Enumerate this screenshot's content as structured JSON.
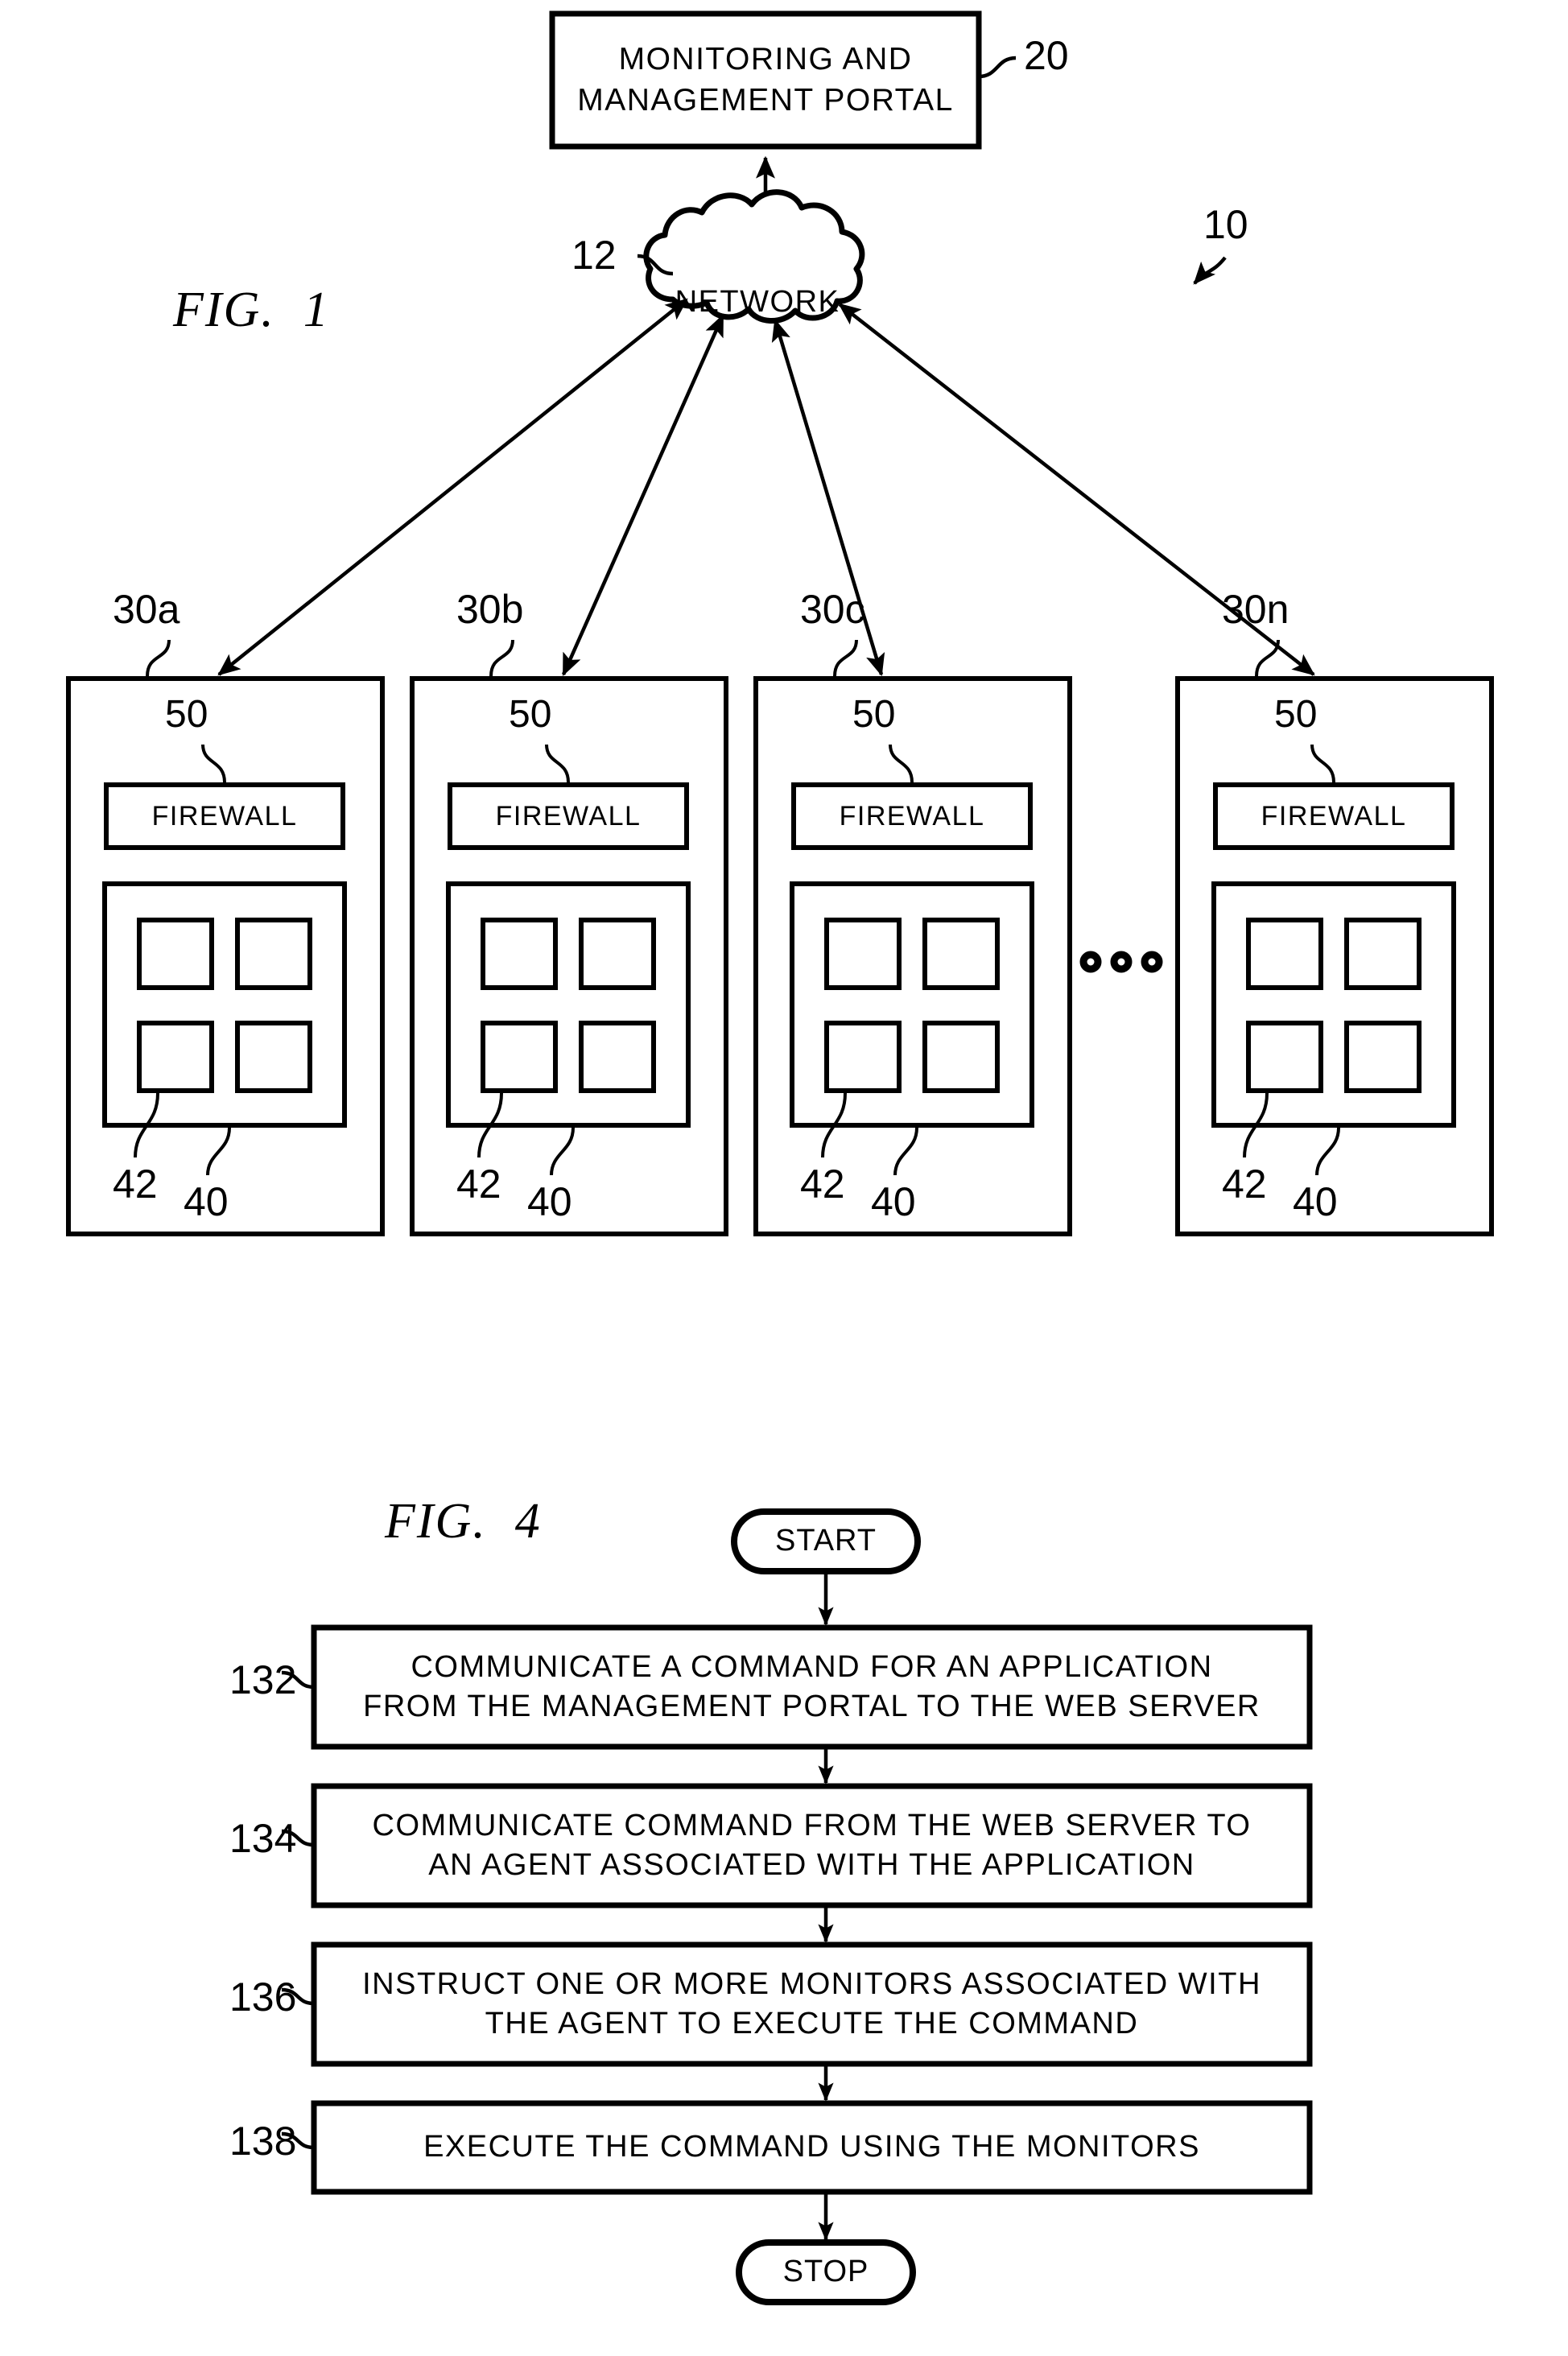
{
  "figures": [
    {
      "id": "fig1",
      "label": "FIG.  1",
      "system_ref": "10",
      "portal": {
        "title": "MONITORING AND\nMANAGEMENT PORTAL",
        "ref": "20"
      },
      "network": {
        "label": "NETWORK",
        "ref": "12"
      },
      "servers": [
        {
          "ref": "30a",
          "firewall_label": "FIREWALL",
          "firewall_ref": "50",
          "agent_ref": "40",
          "monitor_ref": "42"
        },
        {
          "ref": "30b",
          "firewall_label": "FIREWALL",
          "firewall_ref": "50",
          "agent_ref": "40",
          "monitor_ref": "42"
        },
        {
          "ref": "30c",
          "firewall_label": "FIREWALL",
          "firewall_ref": "50",
          "agent_ref": "40",
          "monitor_ref": "42"
        },
        {
          "ref": "30n",
          "firewall_label": "FIREWALL",
          "firewall_ref": "50",
          "agent_ref": "40",
          "monitor_ref": "42"
        }
      ],
      "ellipsis": "○ ○ ○"
    },
    {
      "id": "fig4",
      "label": "FIG.  4",
      "start_label": "START",
      "stop_label": "STOP",
      "steps": [
        {
          "ref": "132",
          "text": "COMMUNICATE A COMMAND FOR AN APPLICATION\nFROM THE MANAGEMENT PORTAL TO THE WEB SERVER"
        },
        {
          "ref": "134",
          "text": "COMMUNICATE COMMAND FROM THE WEB SERVER TO\nAN AGENT ASSOCIATED WITH THE APPLICATION"
        },
        {
          "ref": "136",
          "text": "INSTRUCT ONE OR MORE MONITORS ASSOCIATED WITH\nTHE AGENT TO EXECUTE THE COMMAND"
        },
        {
          "ref": "138",
          "text": "EXECUTE THE COMMAND USING THE MONITORS"
        }
      ]
    }
  ],
  "colors": {
    "ink": "#000000",
    "paper": "#ffffff"
  }
}
